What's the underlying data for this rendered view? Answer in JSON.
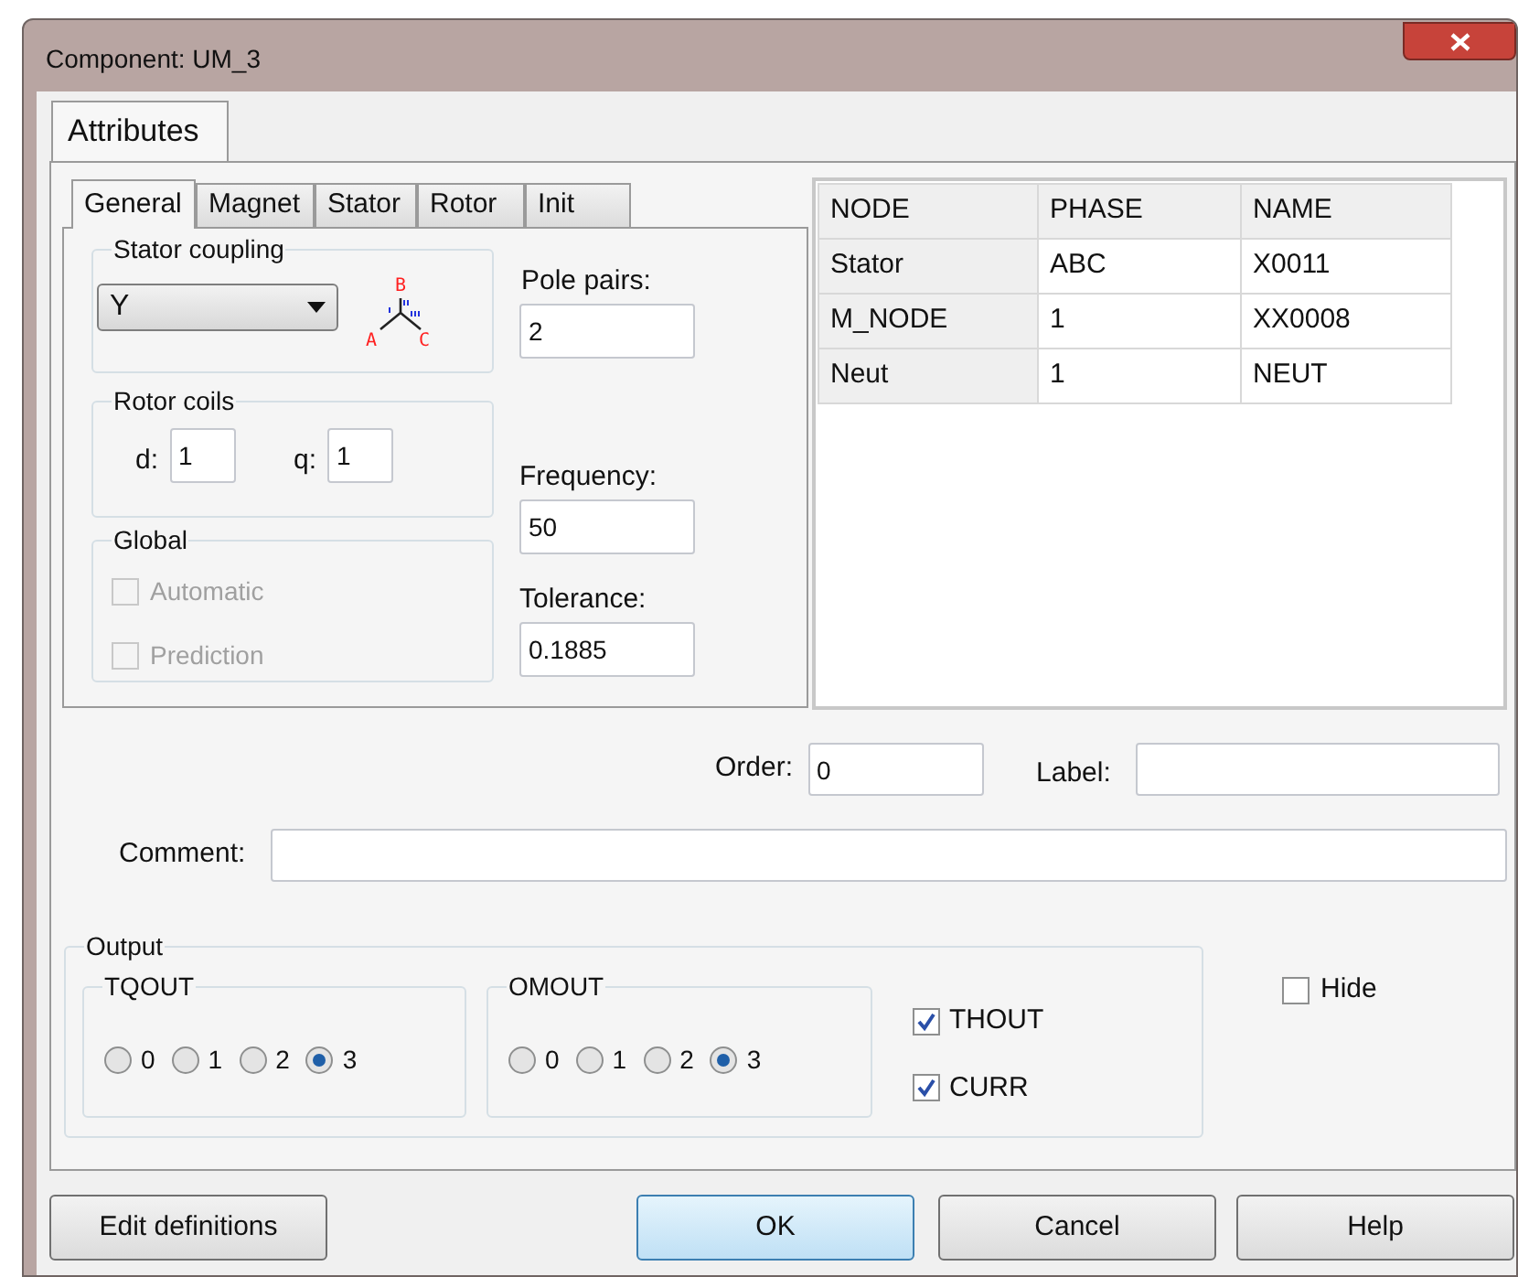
{
  "window": {
    "title": "Component: UM_3"
  },
  "tabs": [
    {
      "label": "Attributes",
      "selected": true
    }
  ],
  "subtabs": [
    {
      "label": "General",
      "selected": true
    },
    {
      "label": "Magnet",
      "selected": false
    },
    {
      "label": "Stator",
      "selected": false
    },
    {
      "label": "Rotor",
      "selected": false
    },
    {
      "label": "Init",
      "selected": false
    }
  ],
  "stator_coupling": {
    "label": "Stator coupling",
    "value": "Y",
    "diagram_labels": [
      "A",
      "B",
      "C"
    ]
  },
  "rotor_coils": {
    "label": "Rotor coils",
    "fields": [
      {
        "label": "d:",
        "value": "1"
      },
      {
        "label": "q:",
        "value": "1"
      }
    ]
  },
  "global": {
    "label": "Global",
    "options": [
      {
        "label": "Automatic",
        "checked": false,
        "disabled": true
      },
      {
        "label": "Prediction",
        "checked": false,
        "disabled": true
      }
    ]
  },
  "parameters": [
    {
      "label": "Pole pairs:",
      "value": "2"
    },
    {
      "label": "Frequency:",
      "value": "50"
    },
    {
      "label": "Tolerance:",
      "value": "0.1885"
    }
  ],
  "table": {
    "columns": [
      "NODE",
      "PHASE",
      "NAME"
    ],
    "rows": [
      [
        "Stator",
        "ABC",
        "X0011"
      ],
      [
        "M_NODE",
        "1",
        "XX0008"
      ],
      [
        "Neut",
        "1",
        "NEUT"
      ]
    ]
  },
  "order": {
    "label": "Order:",
    "value": "0"
  },
  "label_field": {
    "label": "Label:"
  },
  "comment": {
    "label": "Comment:"
  },
  "output": {
    "label": "Output",
    "groups": [
      {
        "label": "TQOUT",
        "options": [
          {
            "label": "0",
            "selected": false
          },
          {
            "label": "1",
            "selected": false
          },
          {
            "label": "2",
            "selected": false
          },
          {
            "label": "3",
            "selected": true
          }
        ]
      },
      {
        "label": "OMOUT",
        "options": [
          {
            "label": "0",
            "selected": false
          },
          {
            "label": "1",
            "selected": false
          },
          {
            "label": "2",
            "selected": false
          },
          {
            "label": "3",
            "selected": true
          }
        ]
      }
    ],
    "checks": [
      {
        "label": "THOUT",
        "checked": true
      },
      {
        "label": "CURR",
        "checked": true
      }
    ]
  },
  "hide": {
    "label": "Hide",
    "checked": false
  },
  "buttons": [
    {
      "label": "Edit definitions",
      "default": false
    },
    {
      "label": "OK",
      "default": true
    },
    {
      "label": "Cancel",
      "default": false
    },
    {
      "label": "Help",
      "default": false
    }
  ]
}
